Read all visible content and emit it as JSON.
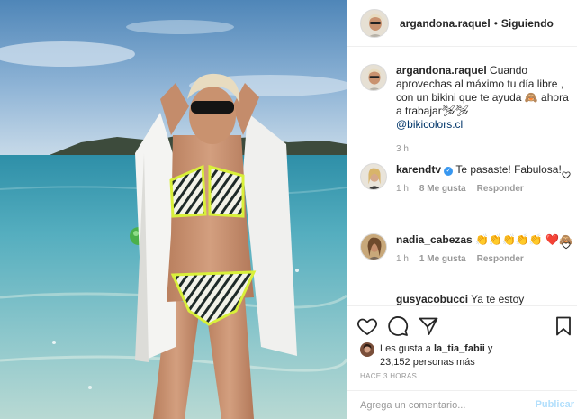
{
  "post": {
    "username": "argandona.raquel",
    "follow_status": "Siguiendo",
    "separator": "•"
  },
  "caption": {
    "username": "argandona.raquel",
    "text": "Cuando aprovechas al máximo tu día libre , con un bikini que te ayuda 🙈 ahora a trabajar🛩🛩",
    "mention": "@bikicolors.cl",
    "time": "3 h"
  },
  "comments": [
    {
      "username": "karendtv",
      "verified": true,
      "text": "Te pasaste! Fabulosa!",
      "time": "1 h",
      "likes": "8 Me gusta",
      "reply": "Responder"
    },
    {
      "username": "nadia_cabezas",
      "verified": false,
      "text": "👏👏👏👏👏 ❤️🙈",
      "time": "1 h",
      "likes": "1 Me gusta",
      "reply": "Responder"
    },
    {
      "username": "gusyacobucci",
      "verified": false,
      "text": "Ya te estoy"
    }
  ],
  "likes": {
    "prefix": "Les gusta a",
    "first_user": "la_tia_fabii",
    "connector": "y",
    "others": "23,152 personas más"
  },
  "time_ago": "HACE 3 HORAS",
  "add_comment": {
    "placeholder": "Agrega un comentario...",
    "post_label": "Publicar"
  },
  "icons": {
    "like": "heart-icon",
    "comment": "comment-icon",
    "share": "share-icon",
    "save": "bookmark-icon",
    "comment_like": "small-heart-icon"
  },
  "colors": {
    "link": "#003569",
    "verified": "#3897f0",
    "muted": "#999999",
    "post_button": "#b2dffc",
    "border": "#efefef"
  }
}
